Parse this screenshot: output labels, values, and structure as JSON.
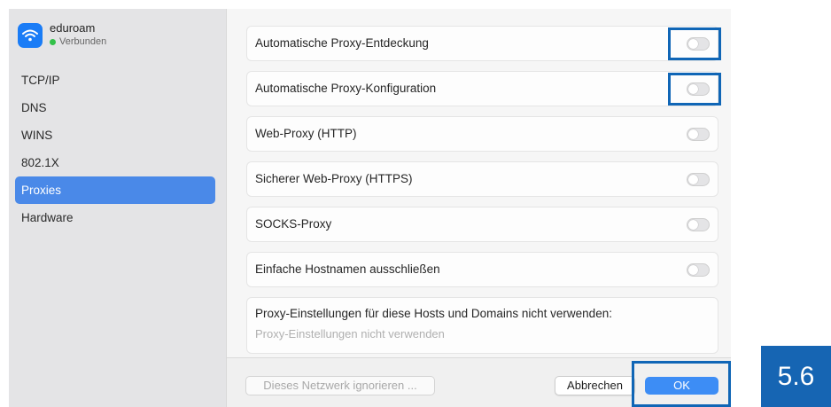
{
  "sidebar": {
    "network": {
      "name": "eduroam",
      "status": "Verbunden"
    },
    "items": [
      {
        "label": "TCP/IP"
      },
      {
        "label": "DNS"
      },
      {
        "label": "WINS"
      },
      {
        "label": "802.1X"
      },
      {
        "label": "Proxies"
      },
      {
        "label": "Hardware"
      }
    ],
    "active": "Proxies"
  },
  "proxies": [
    {
      "label": "Automatische Proxy-Entdeckung",
      "enabled": false
    },
    {
      "label": "Automatische Proxy-Konfiguration",
      "enabled": false
    },
    {
      "label": "Web-Proxy (HTTP)",
      "enabled": false
    },
    {
      "label": "Sicherer Web-Proxy (HTTPS)",
      "enabled": false
    },
    {
      "label": "SOCKS-Proxy",
      "enabled": false
    },
    {
      "label": "Einfache Hostnamen ausschließen",
      "enabled": false
    }
  ],
  "bypass": {
    "label": "Proxy-Einstellungen für diese Hosts und Domains nicht verwenden:",
    "placeholder": "Proxy-Einstellungen nicht verwenden"
  },
  "footer": {
    "ignore_label": "Dieses Netzwerk ignorieren ...",
    "cancel_label": "Abbrechen",
    "ok_label": "OK"
  },
  "step_badge": "5.6",
  "colors": {
    "accent": "#1a7cf6",
    "highlight": "#1066b6",
    "selected": "#4a89e8",
    "status_ok": "#33c14a"
  }
}
